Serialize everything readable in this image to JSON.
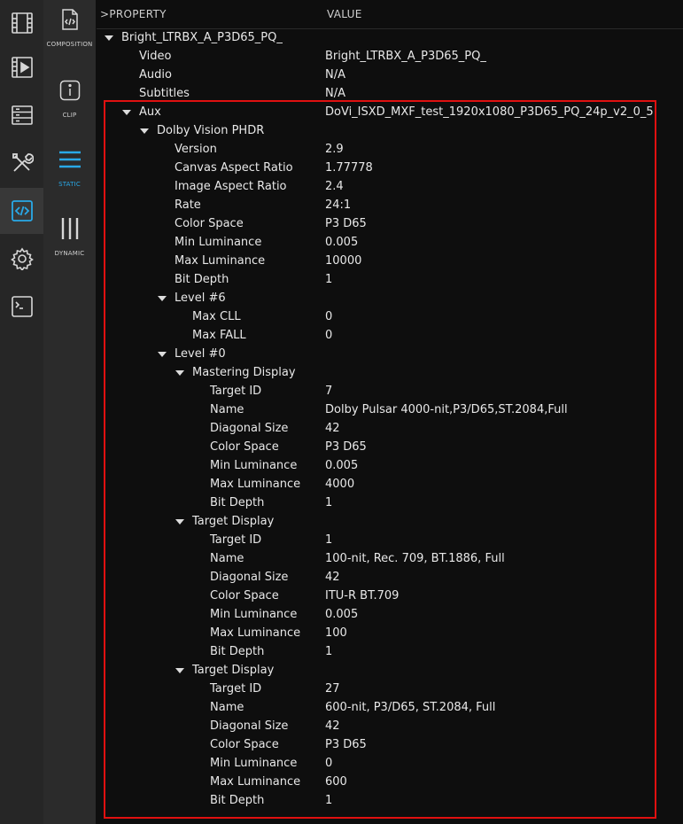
{
  "sidebar": {
    "items": [
      {
        "name": "film-strip-icon",
        "active": false
      },
      {
        "name": "video-player-icon",
        "active": false
      },
      {
        "name": "storage-icon",
        "active": false
      },
      {
        "name": "tools-icon",
        "active": false
      },
      {
        "name": "code-icon",
        "active": true
      },
      {
        "name": "gear-icon",
        "active": false
      },
      {
        "name": "terminal-icon",
        "active": false
      }
    ]
  },
  "subnav": {
    "items": [
      {
        "label": "COMPOSITION",
        "icon": "composition-file-icon",
        "active": false
      },
      {
        "label": "CLIP",
        "icon": "info-icon",
        "active": false
      },
      {
        "label": "STATIC",
        "icon": "hamburger-icon",
        "active": true
      },
      {
        "label": "DYNAMIC",
        "icon": "vertical-bars-icon",
        "active": false
      }
    ]
  },
  "header": {
    "property": ">PROPERTY",
    "value": "VALUE"
  },
  "tree": [
    {
      "name": "Bright_LTRBX_A_P3D65_PQ_",
      "value": "",
      "depth": 0,
      "caret": true
    },
    {
      "name": "Video",
      "value": "Bright_LTRBX_A_P3D65_PQ_",
      "depth": 1,
      "caret": false
    },
    {
      "name": "Audio",
      "value": "N/A",
      "depth": 1,
      "caret": false
    },
    {
      "name": "Subtitles",
      "value": "N/A",
      "depth": 1,
      "caret": false
    },
    {
      "name": "Aux",
      "value": "DoVi_ISXD_MXF_test_1920x1080_P3D65_PQ_24p_v2_0_5",
      "depth": 1,
      "caret": true
    },
    {
      "name": "Dolby Vision PHDR",
      "value": "",
      "depth": 2,
      "caret": true
    },
    {
      "name": "Version",
      "value": "2.9",
      "depth": 3,
      "caret": false
    },
    {
      "name": "Canvas Aspect Ratio",
      "value": "1.77778",
      "depth": 3,
      "caret": false
    },
    {
      "name": "Image Aspect Ratio",
      "value": "2.4",
      "depth": 3,
      "caret": false
    },
    {
      "name": "Rate",
      "value": "24:1",
      "depth": 3,
      "caret": false
    },
    {
      "name": "Color Space",
      "value": "P3 D65",
      "depth": 3,
      "caret": false
    },
    {
      "name": "Min Luminance",
      "value": "0.005",
      "depth": 3,
      "caret": false
    },
    {
      "name": "Max Luminance",
      "value": "10000",
      "depth": 3,
      "caret": false
    },
    {
      "name": "Bit Depth",
      "value": "1",
      "depth": 3,
      "caret": false
    },
    {
      "name": "Level #6",
      "value": "",
      "depth": 3,
      "caret": true
    },
    {
      "name": "Max CLL",
      "value": "0",
      "depth": 4,
      "caret": false
    },
    {
      "name": "Max FALL",
      "value": "0",
      "depth": 4,
      "caret": false
    },
    {
      "name": "Level #0",
      "value": "",
      "depth": 3,
      "caret": true
    },
    {
      "name": "Mastering Display",
      "value": "",
      "depth": 4,
      "caret": true
    },
    {
      "name": "Target ID",
      "value": "7",
      "depth": 5,
      "caret": false
    },
    {
      "name": "Name",
      "value": "Dolby Pulsar 4000-nit,P3/D65,ST.2084,Full",
      "depth": 5,
      "caret": false
    },
    {
      "name": "Diagonal Size",
      "value": "42",
      "depth": 5,
      "caret": false
    },
    {
      "name": "Color Space",
      "value": "P3 D65",
      "depth": 5,
      "caret": false
    },
    {
      "name": "Min Luminance",
      "value": "0.005",
      "depth": 5,
      "caret": false
    },
    {
      "name": "Max Luminance",
      "value": "4000",
      "depth": 5,
      "caret": false
    },
    {
      "name": "Bit Depth",
      "value": "1",
      "depth": 5,
      "caret": false
    },
    {
      "name": "Target Display",
      "value": "",
      "depth": 4,
      "caret": true
    },
    {
      "name": "Target ID",
      "value": "1",
      "depth": 5,
      "caret": false
    },
    {
      "name": "Name",
      "value": "100-nit, Rec. 709, BT.1886, Full",
      "depth": 5,
      "caret": false
    },
    {
      "name": "Diagonal Size",
      "value": "42",
      "depth": 5,
      "caret": false
    },
    {
      "name": "Color Space",
      "value": "ITU-R BT.709",
      "depth": 5,
      "caret": false
    },
    {
      "name": "Min Luminance",
      "value": "0.005",
      "depth": 5,
      "caret": false
    },
    {
      "name": "Max Luminance",
      "value": "100",
      "depth": 5,
      "caret": false
    },
    {
      "name": "Bit Depth",
      "value": "1",
      "depth": 5,
      "caret": false
    },
    {
      "name": "Target Display",
      "value": "",
      "depth": 4,
      "caret": true
    },
    {
      "name": "Target ID",
      "value": "27",
      "depth": 5,
      "caret": false
    },
    {
      "name": "Name",
      "value": "600-nit, P3/D65, ST.2084, Full",
      "depth": 5,
      "caret": false
    },
    {
      "name": "Diagonal Size",
      "value": "42",
      "depth": 5,
      "caret": false
    },
    {
      "name": "Color Space",
      "value": "P3 D65",
      "depth": 5,
      "caret": false
    },
    {
      "name": "Min Luminance",
      "value": "0",
      "depth": 5,
      "caret": false
    },
    {
      "name": "Max Luminance",
      "value": "600",
      "depth": 5,
      "caret": false
    },
    {
      "name": "Bit Depth",
      "value": "1",
      "depth": 5,
      "caret": false
    }
  ],
  "colors": {
    "accent": "#29a9e8",
    "highlight": "#e01010",
    "background": "#0e0e0e"
  }
}
